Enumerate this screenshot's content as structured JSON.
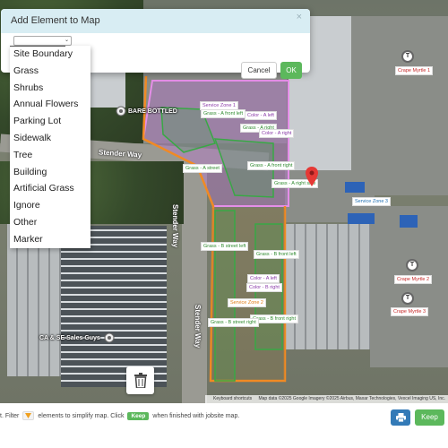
{
  "dialog": {
    "title": "Add Element to Map",
    "close_glyph": "×",
    "select_value": "",
    "cancel_label": "Cancel",
    "ok_label": "OK",
    "options": [
      "Site Boundary",
      "Grass",
      "Shrubs",
      "Annual Flowers",
      "Parking Lot",
      "Sidewalk",
      "Tree",
      "Building",
      "Artificial Grass",
      "Ignore",
      "Other",
      "Marker"
    ]
  },
  "map": {
    "streets": [
      "Stender Way",
      "Stender Way",
      "Stender Way"
    ],
    "places": [
      "BARE BOTTLED",
      "CA & SE Sales Guys"
    ],
    "tags": [
      "Service Zone 1",
      "Grass - A front left",
      "Color - A left",
      "Grass - A right",
      "Color - A right",
      "Grass - A street",
      "Grass - A front right",
      "Grass - A right side",
      "Service Zone 3",
      "Grass - B street left",
      "Grass - B front left",
      "Color - A left",
      "Color - B right",
      "Service Zone 2",
      "Grass - B front right",
      "Grass - B street right"
    ],
    "tree_labels": [
      "Crape Myrtle 1",
      "Crape Myrtle 2",
      "Crape Myrtle 3"
    ],
    "tree_pin_glyph": "T",
    "attribution": {
      "shortcuts": "Keyboard shortcuts",
      "credits": "Map data ©2025 Google Imagery ©2025 Airbus, Maxar Technologies, Vexcel Imaging US, Inc."
    },
    "colors": {
      "boundary": "#f08a24",
      "grass": "#39a845",
      "color_zone": "#d24bd8",
      "marker": "#e53935"
    }
  },
  "bottombar": {
    "text_before": "t. Filter",
    "text_mid": "elements to simplify map. Click",
    "keep_chip": "Keep",
    "text_after": "when finished with jobsite map.",
    "keep_label": "Keep"
  }
}
